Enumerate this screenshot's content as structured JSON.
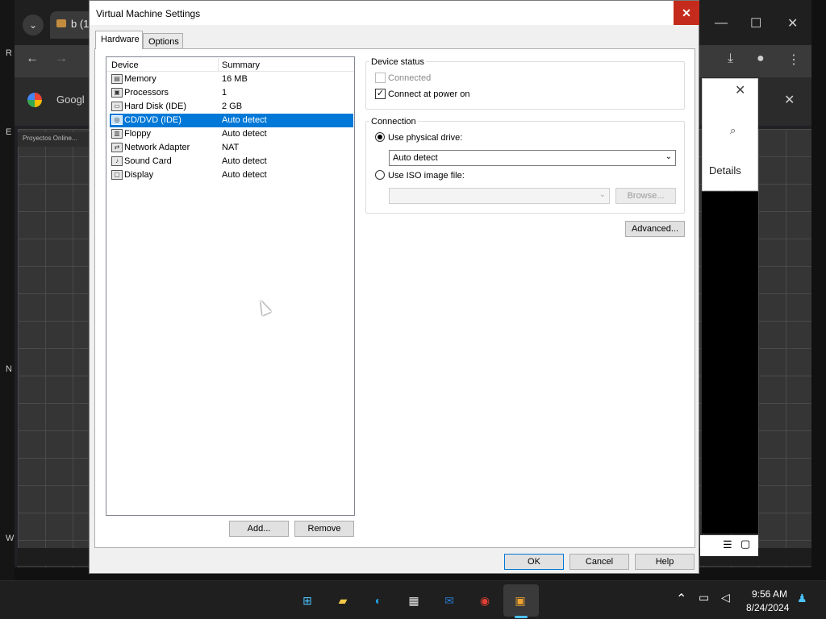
{
  "window": {
    "title": "Virtual Machine Settings",
    "close_glyph": "✕"
  },
  "tabs": [
    {
      "label": "Hardware",
      "active": true
    },
    {
      "label": "Options",
      "active": false
    }
  ],
  "device_list": {
    "headers": {
      "device": "Device",
      "summary": "Summary"
    },
    "rows": [
      {
        "device": "Memory",
        "summary": "16 MB",
        "icon": "memory-icon",
        "glyph": "▤"
      },
      {
        "device": "Processors",
        "summary": "1",
        "icon": "processor-icon",
        "glyph": "▣"
      },
      {
        "device": "Hard Disk (IDE)",
        "summary": "2 GB",
        "icon": "hard-disk-icon",
        "glyph": "▭"
      },
      {
        "device": "CD/DVD (IDE)",
        "summary": "Auto detect",
        "icon": "cd-dvd-icon",
        "glyph": "◎",
        "selected": true
      },
      {
        "device": "Floppy",
        "summary": "Auto detect",
        "icon": "floppy-icon",
        "glyph": "▥"
      },
      {
        "device": "Network Adapter",
        "summary": "NAT",
        "icon": "network-adapter-icon",
        "glyph": "⇄"
      },
      {
        "device": "Sound Card",
        "summary": "Auto detect",
        "icon": "sound-card-icon",
        "glyph": "♪"
      },
      {
        "device": "Display",
        "summary": "Auto detect",
        "icon": "display-icon",
        "glyph": "▢"
      }
    ],
    "add_label": "Add...",
    "remove_label": "Remove"
  },
  "device_status": {
    "title": "Device status",
    "connected_label": "Connected",
    "connected_checked": false,
    "connected_enabled": false,
    "power_on_label": "Connect at power on",
    "power_on_checked": true
  },
  "connection": {
    "title": "Connection",
    "physical_label": "Use physical drive:",
    "physical_selected": true,
    "physical_value": "Auto detect",
    "iso_label": "Use ISO image file:",
    "iso_selected": false,
    "iso_value": "",
    "browse_label": "Browse..."
  },
  "advanced_label": "Advanced...",
  "footer": {
    "ok_label": "OK",
    "cancel_label": "Cancel",
    "help_label": "Help"
  },
  "background": {
    "chrome_tab_label": "b (1",
    "google_label": "Googl",
    "find_details_label": "Details",
    "vm_bar_label": "Proyectos Online...",
    "edge_letters": [
      "R",
      "E",
      "N",
      "W"
    ]
  },
  "taskbar": {
    "time": "9:56 AM",
    "date": "8/24/2024",
    "apps": [
      {
        "name": "start-icon",
        "glyph": "⊞",
        "color": "#4cc2ff"
      },
      {
        "name": "file-explorer-icon",
        "glyph": "▰",
        "color": "#f7c948"
      },
      {
        "name": "edge-icon",
        "glyph": "◐",
        "color": "#1fa0e0"
      },
      {
        "name": "store-icon",
        "glyph": "▦",
        "color": "#e6e6e6"
      },
      {
        "name": "outlook-icon",
        "glyph": "✉",
        "color": "#2a7bd4"
      },
      {
        "name": "chrome-icon",
        "glyph": "◉",
        "color": "#e44134"
      },
      {
        "name": "vmware-icon",
        "glyph": "▣",
        "color": "#f0a430"
      }
    ]
  }
}
